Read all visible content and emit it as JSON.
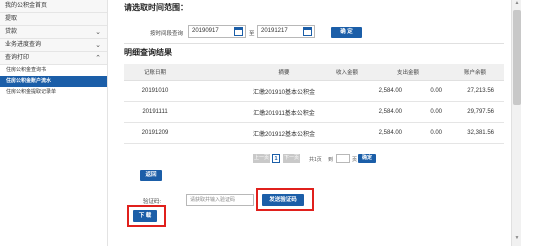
{
  "sidebar": {
    "items": [
      {
        "label": "我的公积金首页",
        "chevron": ""
      },
      {
        "label": "提取",
        "chevron": ""
      },
      {
        "label": "贷款",
        "chevron": "⌄"
      },
      {
        "label": "业务进度查询",
        "chevron": "⌄"
      },
      {
        "label": "查询打印",
        "chevron": "⌃"
      }
    ],
    "subitems": [
      {
        "label": "住房公积金查询书",
        "active": false
      },
      {
        "label": "住房公积金账户流水",
        "active": true
      },
      {
        "label": "住房公积金提取记录单",
        "active": false
      }
    ]
  },
  "query": {
    "section_title": "请选取时间范围：",
    "range_label": "按时间段查询",
    "start_date": "20190917",
    "to_label": "至",
    "end_date": "20191217",
    "confirm_label": "确 定"
  },
  "results": {
    "section_title": "明细查询结果",
    "headers": [
      "记账日期",
      "摘要",
      "收入金额",
      "支出金额",
      "账户余额"
    ],
    "rows": [
      {
        "date": "20191010",
        "desc": "汇缴201910基本公积金",
        "income": "2,584.00",
        "expense": "0.00",
        "balance": "27,213.56"
      },
      {
        "date": "20191111",
        "desc": "汇缴201911基本公积金",
        "income": "2,584.00",
        "expense": "0.00",
        "balance": "29,797.56"
      },
      {
        "date": "20191209",
        "desc": "汇缴201912基本公积金",
        "income": "2,584.00",
        "expense": "0.00",
        "balance": "32,381.56"
      }
    ]
  },
  "pager": {
    "prev_label": "上一页",
    "current_page": "1",
    "next_label": "下一页",
    "total_label": "共1页",
    "goto_label": "到",
    "page_unit": "页",
    "confirm_label": "确定"
  },
  "actions": {
    "back_label": "返回",
    "verify_label": "验证码:",
    "verify_placeholder": "请获取并输入验证码",
    "send_code_label": "发送验证码",
    "download_label": "下 载"
  },
  "colors": {
    "primary": "#1b5ea8",
    "highlight_border": "#e0201c"
  }
}
